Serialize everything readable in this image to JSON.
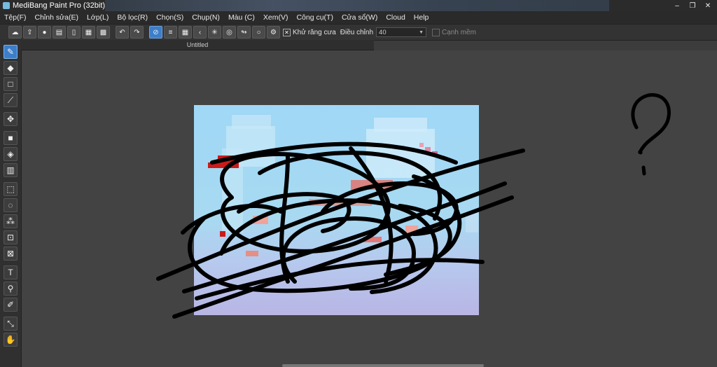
{
  "window": {
    "title": "MediBang Paint Pro (32bit)",
    "controls": [
      "–",
      "❐",
      "✕"
    ]
  },
  "menu": [
    "Tệp(F)",
    "Chỉnh sửa(E)",
    "Lớp(L)",
    "Bộ lọc(R)",
    "Chọn(S)",
    "Chụp(N)",
    "Màu (C)",
    "Xem(V)",
    "Công cụ(T)",
    "Cửa sổ(W)",
    "Cloud",
    "Help"
  ],
  "toolbar": {
    "antialias_label": "Khử răng cưa",
    "antialias_checked": true,
    "adjust_label": "Điều chỉnh",
    "adjust_value": "40",
    "soft_edge_label": "Cạnh mềm",
    "soft_edge_checked": false
  },
  "document": {
    "tab_title": "Untitled"
  },
  "annotation_glyph": "?",
  "colors": {
    "accent": "#3d7ec9",
    "sky_top": "#9fd8f6",
    "sky_bottom": "#b9b5e4",
    "scribble": "#000000",
    "pixel_red": "#cc1a1a"
  }
}
